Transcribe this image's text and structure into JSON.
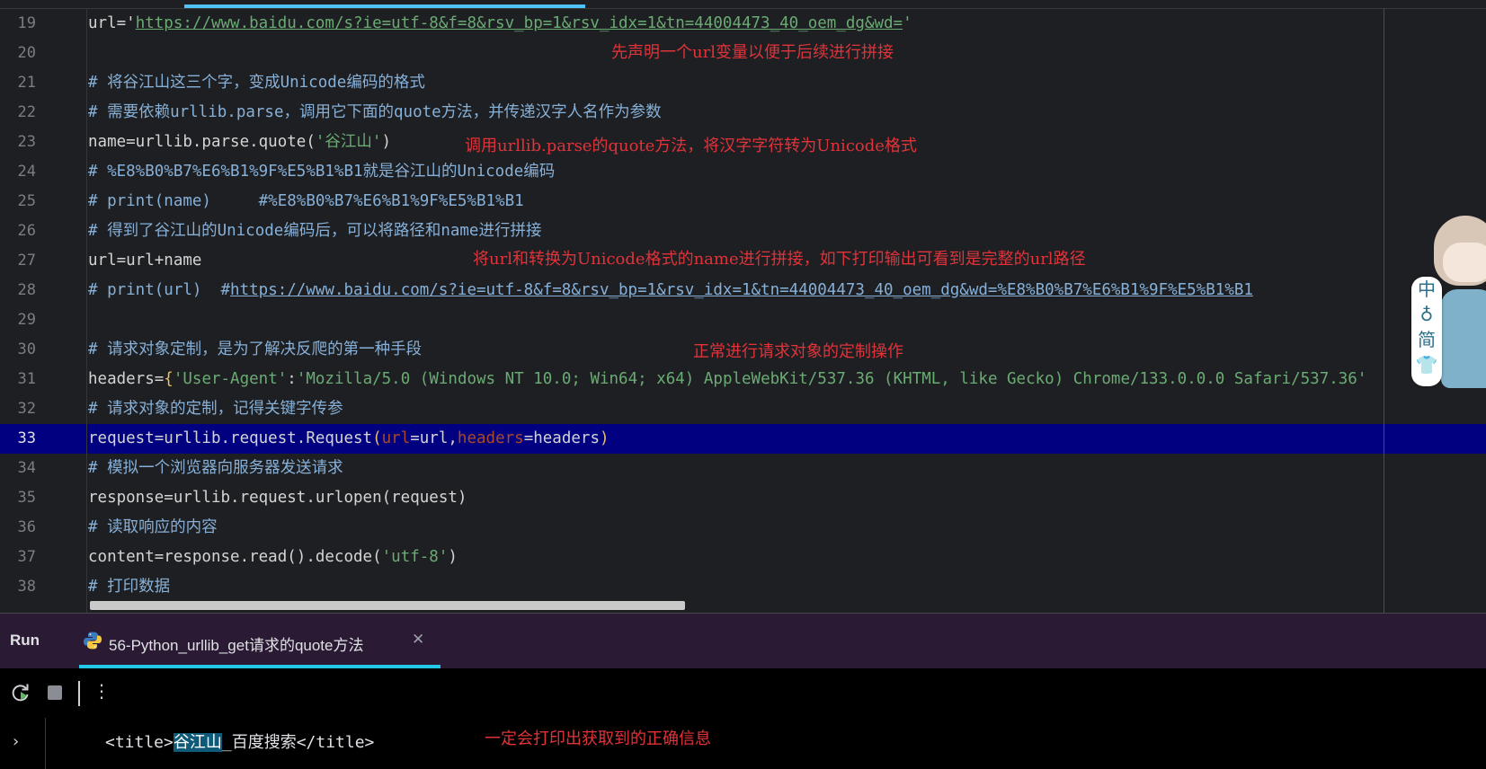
{
  "colors": {
    "editor_bg": "#1e1f22",
    "current_line_bg": "#000080",
    "comment": "#87b0d8",
    "string": "#6aab73",
    "param": "#aa4926",
    "annotation": "#e0333a",
    "run_header_bg": "#2b1a33",
    "tab_accent": "#22c8e6",
    "highlight": "#0e5a78"
  },
  "editor": {
    "current_line": "33",
    "lines": [
      {
        "num": "19",
        "p1": "url='",
        "p2": "https://www.baidu.com/s?ie=utf-8&f=8&rsv_bp=1&rsv_idx=1&tn=44004473_40_oem_dg&wd=",
        "p3": "'"
      },
      {
        "num": "20"
      },
      {
        "num": "21",
        "text": "# 将谷江山这三个字，变成Unicode编码的格式"
      },
      {
        "num": "22",
        "text": "# 需要依赖urllib.parse，调用它下面的quote方法，并传递汉字人名作为参数"
      },
      {
        "num": "23",
        "p1": "name=urllib.parse.quote(",
        "p2": "'谷江山'",
        "p3": ")"
      },
      {
        "num": "24",
        "text": "# %E8%B0%B7%E6%B1%9F%E5%B1%B1就是谷江山的Unicode编码"
      },
      {
        "num": "25",
        "text": "# print(name)     #%E8%B0%B7%E6%B1%9F%E5%B1%B1"
      },
      {
        "num": "26",
        "text": "# 得到了谷江山的Unicode编码后，可以将路径和name进行拼接"
      },
      {
        "num": "27",
        "text": "url=url+name"
      },
      {
        "num": "28",
        "p1": "# print(url)  #",
        "p2": "https://www.baidu.com/s?ie=utf-8&f=8&rsv_bp=1&rsv_idx=1&tn=44004473_40_oem_dg&wd=%E8%B0%B7%E6%B1%9F%E5%B1%B1"
      },
      {
        "num": "29"
      },
      {
        "num": "30",
        "text": "# 请求对象定制，是为了解决反爬的第一种手段"
      },
      {
        "num": "31",
        "p1": "headers=",
        "p2": "{",
        "p3": "'User-Agent'",
        "p4": ":",
        "p5": "'Mozilla/5.0 (Windows NT 10.0; Win64; x64) AppleWebKit/537.36 (KHTML, like Gecko) Chrome/133.0.0.0 Safari/537.36'"
      },
      {
        "num": "32",
        "text": "# 请求对象的定制，记得关键字传参"
      },
      {
        "num": "33",
        "p1": "request=urllib.request.Request",
        "p2": "(",
        "p3": "url",
        "p4": "=url,",
        "p5": "headers",
        "p6": "=headers",
        "p7": ")"
      },
      {
        "num": "34",
        "text": "# 模拟一个浏览器向服务器发送请求"
      },
      {
        "num": "35",
        "text": "response=urllib.request.urlopen(request)"
      },
      {
        "num": "36",
        "text": "# 读取响应的内容"
      },
      {
        "num": "37",
        "p1": "content=response.read().decode(",
        "p2": "'utf-8'",
        "p3": ")"
      },
      {
        "num": "38",
        "text": "# 打印数据"
      }
    ]
  },
  "annotations": {
    "a1": "先声明一个url变量以便于后续进行拼接",
    "a2": "调用urllib.parse的quote方法，将汉字字符转为Unicode格式",
    "a3": "将url和转换为Unicode格式的name进行拼接，如下打印输出可看到是完整的url路径",
    "a4": "正常进行请求对象的定制操作",
    "a5": "一定会打印出获取到的正确信息"
  },
  "sticker": {
    "chars": [
      "中",
      "♁",
      "简",
      "👕"
    ]
  },
  "run": {
    "label": "Run",
    "tab_title": "56-Python_urllib_get请求的quote方法",
    "tab_close": "✕",
    "toolbar_more": "⋮",
    "output": {
      "before": "<title>",
      "highlight": "谷江山",
      "after": "_百度搜索</title>"
    },
    "expand_icon": "›"
  }
}
